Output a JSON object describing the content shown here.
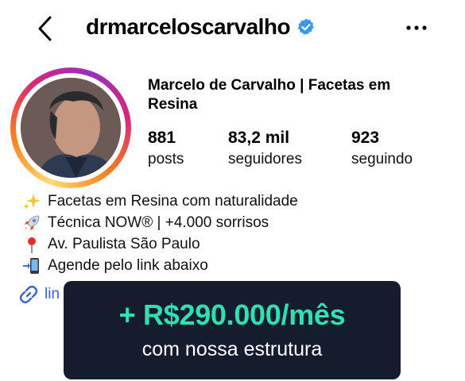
{
  "header": {
    "username": "drmarceloscarvalho",
    "back_icon": "chevron-left-icon",
    "verified_icon": "verified-badge-icon",
    "more_icon": "more-horizontal-icon"
  },
  "profile": {
    "display_name": "Marcelo de Carvalho | Facetas em Resina",
    "stats": [
      {
        "value": "881",
        "label": "posts"
      },
      {
        "value": "83,2 mil",
        "label": "seguidores"
      },
      {
        "value": "923",
        "label": "seguindo"
      }
    ]
  },
  "bio": [
    {
      "icon": "sparkles-icon",
      "text": "Facetas em Resina com naturalidade"
    },
    {
      "icon": "rocket-icon",
      "text": "Técnica NOW® | +4.000 sorrisos"
    },
    {
      "icon": "pin-icon",
      "text": "Av. Paulista São Paulo"
    },
    {
      "icon": "phone-arrow-icon",
      "text": "Agende pelo link abaixo"
    }
  ],
  "link": {
    "icon": "link-icon",
    "text": "lin"
  },
  "overlay": {
    "amount": "+ R$290.000/mês",
    "subtitle": "com nossa estrutura"
  },
  "colors": {
    "verified": "#3897f0",
    "link": "#3a61d8",
    "overlay_bg": "#141c2e",
    "overlay_accent": "#2fe0b0"
  }
}
